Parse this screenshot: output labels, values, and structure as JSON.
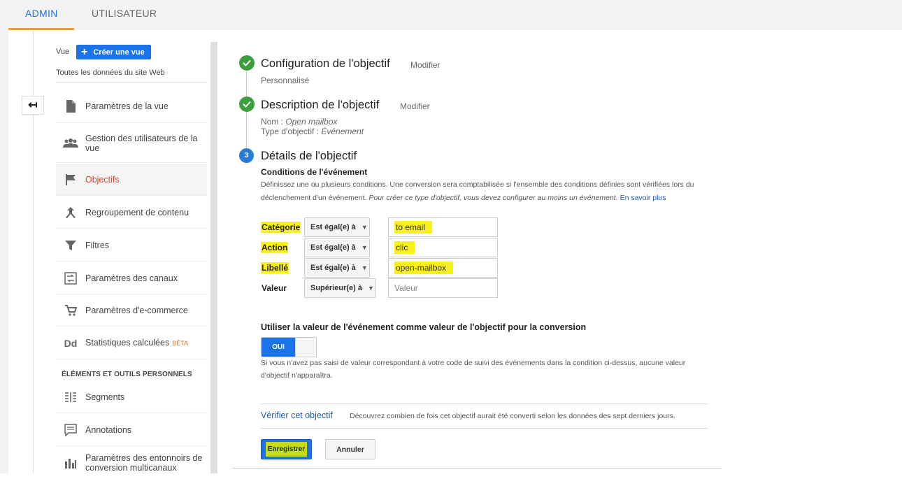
{
  "tabs": {
    "admin": "ADMIN",
    "user": "UTILISATEUR"
  },
  "colors": {
    "accent": "#1a73e8",
    "active_nav": "#e0442e",
    "tab_underline": "#e8a33d",
    "check": "#3c9e3c",
    "highlight": "#faf01e"
  },
  "sidebar": {
    "vue_label": "Vue",
    "create_view": "Créer une vue",
    "view_name": "Toutes les données du site Web",
    "items": [
      {
        "label": "Paramètres de la vue",
        "icon": "document-icon"
      },
      {
        "label": "Gestion des utilisateurs de la vue",
        "icon": "users-icon"
      },
      {
        "label": "Objectifs",
        "icon": "flag-icon",
        "active": true
      },
      {
        "label": "Regroupement de contenu",
        "icon": "merge-icon"
      },
      {
        "label": "Filtres",
        "icon": "filter-icon"
      },
      {
        "label": "Paramètres des canaux",
        "icon": "channels-icon"
      },
      {
        "label": "Paramètres d'e-commerce",
        "icon": "cart-icon"
      },
      {
        "label": "Statistiques calculées",
        "icon": "dd-icon",
        "badge": "BÊTA"
      }
    ],
    "section_title": "ÉLÉMENTS ET OUTILS PERSONNELS",
    "personal_items": [
      {
        "label": "Segments",
        "icon": "segments-icon"
      },
      {
        "label": "Annotations",
        "icon": "annotation-icon"
      },
      {
        "label": "Paramètres des entonnoirs de conversion multicanaux",
        "icon": "bar-chart-icon"
      }
    ]
  },
  "steps": {
    "config": {
      "title": "Configuration de l'objectif",
      "modify": "Modifier",
      "value": "Personnalisé"
    },
    "description": {
      "title": "Description de l'objectif",
      "modify": "Modifier",
      "name_label": "Nom : ",
      "name_value": "Open mailbox",
      "type_label": "Type d'objectif : ",
      "type_value": "Événement"
    },
    "details": {
      "number": "3",
      "title": "Détails de l'objectif"
    }
  },
  "conditions": {
    "title": "Conditions de l'événement",
    "desc_plain": "Définissez une ou plusieurs conditions. Une conversion sera comptabilisée si l'ensemble des conditions définies sont vérifiées lors du déclenchement d'un événement. ",
    "desc_italic": "Pour créer ce type d'objectif, vous devez configurer au moins un événement.",
    "desc_link": " En savoir plus",
    "rows": [
      {
        "label": "Catégorie",
        "operator": "Est égal(e) à",
        "value": "to email",
        "placeholder": ""
      },
      {
        "label": "Action",
        "operator": "Est égal(e) à",
        "value": "clic",
        "placeholder": ""
      },
      {
        "label": "Libellé",
        "operator": "Est égal(e) à",
        "value": "open-mailbox",
        "placeholder": ""
      },
      {
        "label": "Valeur",
        "operator": "Supérieur(e) à",
        "value": "",
        "placeholder": "Valeur"
      }
    ]
  },
  "use_value": {
    "title": "Utiliser la valeur de l'événement comme valeur de l'objectif pour la conversion",
    "toggle": "OUI",
    "note": "Si vous n'avez pas saisi de valeur correspondant à votre code de suivi des événements dans la condition ci-dessus, aucune valeur d'objectif n'apparaîtra."
  },
  "verify": {
    "link": "Vérifier cet objectif",
    "desc": "Découvrez combien de fois cet objectif aurait été converti selon les données des sept derniers jours."
  },
  "actions": {
    "save": "Enregistrer",
    "cancel": "Annuler"
  }
}
